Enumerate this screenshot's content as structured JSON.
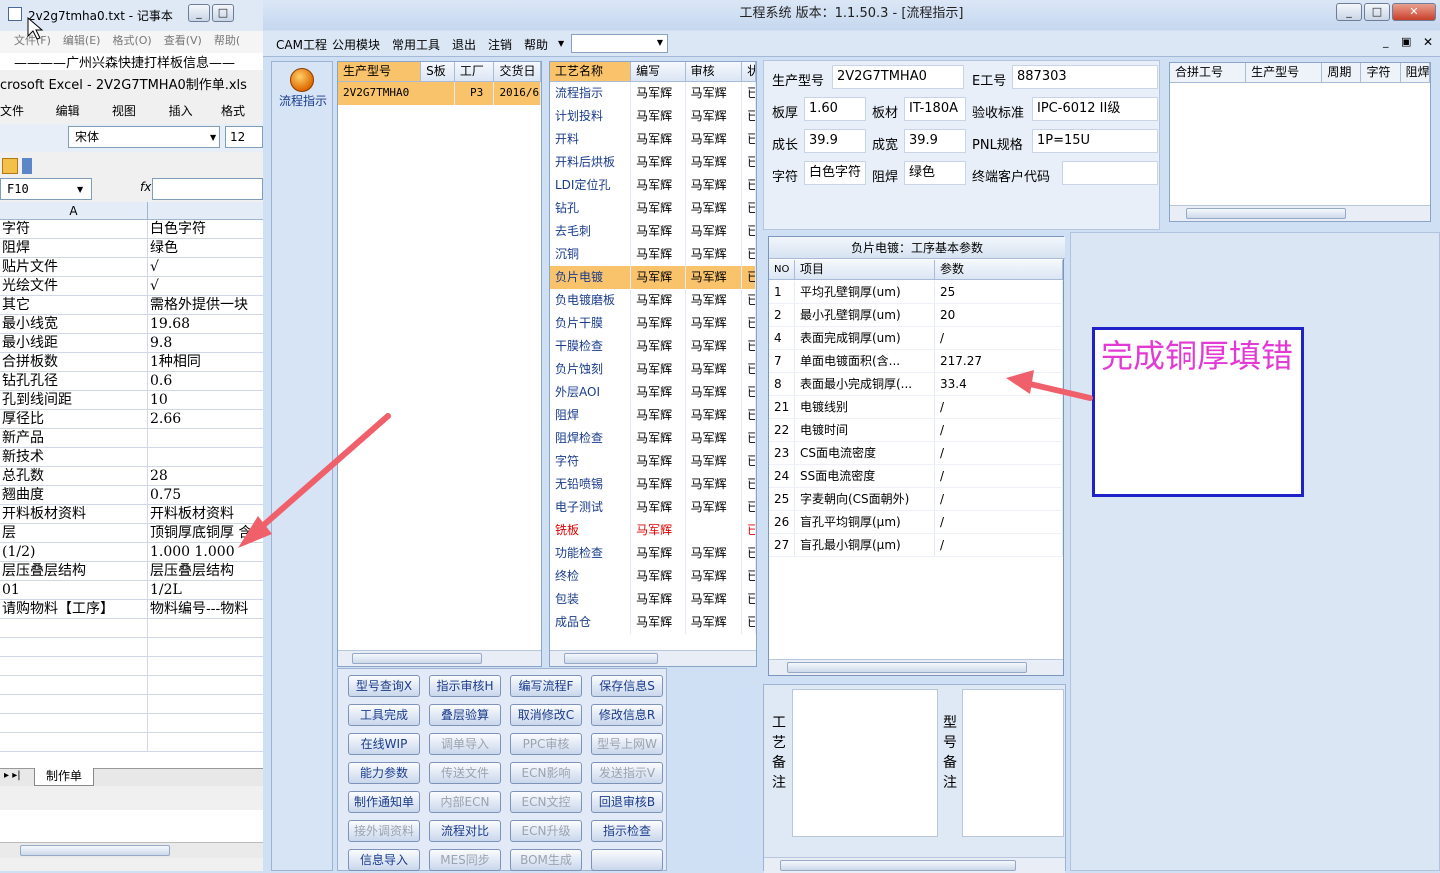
{
  "notepad": {
    "title": "2v2g7tmha0.txt - 记事本",
    "menu": [
      "文件(F)",
      "编辑(E)",
      "格式(O)",
      "查看(V)",
      "帮助("
    ],
    "text": "————广州兴森快捷打样板信息——"
  },
  "excel": {
    "title": "crosoft Excel - 2V2G7TMHA0制作单.xls",
    "menu": [
      "文件(F)",
      "编辑(E)",
      "视图(V)",
      "插入(I)",
      "格式(O)"
    ],
    "font": "宋体",
    "font_size": "12",
    "name_box": "F10",
    "fx": "fx",
    "column_a": "A",
    "rows": [
      [
        "字符",
        "白色字符"
      ],
      [
        "阻焊",
        "绿色"
      ],
      [
        "贴片文件",
        "√"
      ],
      [
        "光绘文件",
        "√"
      ],
      [
        "其它",
        "需格外提供一块"
      ],
      [
        "最小线宽",
        "19.68"
      ],
      [
        "最小线距",
        "9.8"
      ],
      [
        "合拼板数",
        "1种相同"
      ],
      [
        "钻孔孔径",
        "0.6"
      ],
      [
        "孔到线间距",
        "10"
      ],
      [
        "厚径比",
        "2.66"
      ],
      [
        "新产品",
        ""
      ],
      [
        "新技术",
        ""
      ],
      [
        "总孔数",
        "28"
      ],
      [
        "翘曲度",
        "0.75"
      ],
      [
        "开料板材资料",
        "开料板材资料"
      ],
      [
        "层",
        "顶铜厚底铜厚 含"
      ],
      [
        "(1/2)",
        "1.000  1.000"
      ],
      [
        "层压叠层结构",
        "层压叠层结构"
      ],
      [
        "01",
        "1/2L"
      ],
      [
        "请购物料【工序】",
        "物料编号---物料"
      ],
      [
        "",
        ""
      ],
      [
        "",
        ""
      ],
      [
        "",
        ""
      ],
      [
        "",
        ""
      ],
      [
        "",
        ""
      ],
      [
        "",
        ""
      ],
      [
        "",
        ""
      ]
    ],
    "sheet_tab": "制作单",
    "nav_arrows": "▸ ▸|"
  },
  "main": {
    "title": "工程系统   版本：1.1.50.3 - [流程指示]",
    "menu": [
      "CAM工程",
      "公用模块",
      "常用工具",
      "退出",
      "注销",
      "帮助"
    ],
    "nav_label": "流程指示",
    "models": {
      "headers": [
        "生产型号",
        "S板",
        "工厂",
        "交货日"
      ],
      "rows": [
        [
          "2V2G7TMHA0",
          "",
          "P3",
          "2016/6"
        ]
      ]
    },
    "process": {
      "headers": [
        "工艺名称",
        "编写",
        "审核",
        "状"
      ],
      "rows": [
        [
          "流程指示",
          "马军辉",
          "马军辉",
          "已"
        ],
        [
          "计划投料",
          "马军辉",
          "马军辉",
          "已"
        ],
        [
          "开料",
          "马军辉",
          "马军辉",
          "已"
        ],
        [
          "开料后烘板",
          "马军辉",
          "马军辉",
          "已"
        ],
        [
          "LDI定位孔",
          "马军辉",
          "马军辉",
          "已"
        ],
        [
          "钻孔",
          "马军辉",
          "马军辉",
          "已"
        ],
        [
          "去毛刺",
          "马军辉",
          "马军辉",
          "已"
        ],
        [
          "沉铜",
          "马军辉",
          "马军辉",
          "已"
        ],
        [
          "负片电镀",
          "马军辉",
          "马军辉",
          "已"
        ],
        [
          "负电镀磨板",
          "马军辉",
          "马军辉",
          "已"
        ],
        [
          "负片干膜",
          "马军辉",
          "马军辉",
          "已"
        ],
        [
          "干膜检查",
          "马军辉",
          "马军辉",
          "已"
        ],
        [
          "负片蚀刻",
          "马军辉",
          "马军辉",
          "已"
        ],
        [
          "外层AOI",
          "马军辉",
          "马军辉",
          "已"
        ],
        [
          "阻焊",
          "马军辉",
          "马军辉",
          "已"
        ],
        [
          "阻焊检查",
          "马军辉",
          "马军辉",
          "已"
        ],
        [
          "字符",
          "马军辉",
          "马军辉",
          "已"
        ],
        [
          "无铅喷锡",
          "马军辉",
          "马军辉",
          "已"
        ],
        [
          "电子测试",
          "马军辉",
          "马军辉",
          "已"
        ],
        [
          "铣板",
          "马军辉",
          "",
          "已"
        ],
        [
          "功能检查",
          "马军辉",
          "马军辉",
          "已"
        ],
        [
          "终检",
          "马军辉",
          "马军辉",
          "已"
        ],
        [
          "包装",
          "马军辉",
          "马军辉",
          "已"
        ],
        [
          "成品仓",
          "马军辉",
          "马军辉",
          "已"
        ]
      ],
      "selected_index": 8,
      "red_index": 19,
      "red_color": "#e00000"
    },
    "buttons": [
      [
        "型号查询X",
        "指示审核H",
        "编写流程F",
        "保存信息S"
      ],
      [
        "工具完成",
        "叠层验算",
        "取消修改C",
        "修改信息R"
      ],
      [
        "在线WIP",
        "调单导入",
        "PPC审核",
        "型号上网W"
      ],
      [
        "能力参数",
        "传送文件",
        "ECN影响",
        "发送指示V"
      ],
      [
        "制作通知单",
        "内部ECN",
        "ECN文控",
        "回退审核B"
      ],
      [
        "接外调资料",
        "流程对比",
        "ECN升级",
        "指示检查"
      ],
      [
        "信息导入",
        "MES同步",
        "BOM生成",
        ""
      ]
    ],
    "buttons_disabled": [
      [
        false,
        false,
        false,
        false
      ],
      [
        false,
        false,
        false,
        false
      ],
      [
        false,
        true,
        true,
        true
      ],
      [
        false,
        true,
        true,
        true
      ],
      [
        false,
        true,
        true,
        false
      ],
      [
        true,
        false,
        true,
        false
      ],
      [
        false,
        true,
        true,
        false
      ]
    ],
    "info": {
      "model_label": "生产型号",
      "model": "2V2G7TMHA0",
      "e_label": "E工号",
      "e_no": "887303",
      "thickness_label": "板厚",
      "thickness": "1.60",
      "material_label": "板材",
      "material": "IT-180A",
      "std_label": "验收标准",
      "std": "IPC-6012 II级",
      "len_label": "成长",
      "length": "39.9",
      "width_label": "成宽",
      "width": "39.9",
      "pnl_label": "PNL规格",
      "pnl": "1P=15U",
      "char_label": "字符",
      "char": "白色字符",
      "mask_label": "阻焊",
      "mask": "绿色",
      "cust_label": "终端客户代码",
      "cust": ""
    },
    "merge_grid": {
      "headers": [
        "合拼工号",
        "生产型号",
        "周期",
        "字符",
        "阻焊"
      ]
    },
    "params": {
      "title": "负片电镀：工序基本参数",
      "headers": [
        "NO",
        "项目",
        "参数"
      ],
      "rows": [
        [
          "1",
          "平均孔壁铜厚(um)",
          "25"
        ],
        [
          "2",
          "最小孔壁铜厚(um)",
          "20"
        ],
        [
          "4",
          "表面完成铜厚(um)",
          "/"
        ],
        [
          "7",
          "单面电镀面积(含...",
          "217.27"
        ],
        [
          "8",
          "表面最小完成铜厚(...",
          "33.4"
        ],
        [
          "21",
          "电镀线别",
          "/"
        ],
        [
          "22",
          "电镀时间",
          "/"
        ],
        [
          "23",
          "CS面电流密度",
          "/"
        ],
        [
          "24",
          "SS面电流密度",
          "/"
        ],
        [
          "25",
          "字麦朝向(CS面朝外)",
          "/"
        ],
        [
          "26",
          "盲孔平均铜厚(μm)",
          "/"
        ],
        [
          "27",
          "盲孔最小铜厚(μm)",
          "/"
        ]
      ]
    },
    "notes": {
      "process_label": "工艺备注",
      "model_label": "型号备注"
    },
    "annotation": {
      "text": "完成铜厚填错",
      "color": "#e33ad6",
      "border": "#1e22c8"
    }
  }
}
